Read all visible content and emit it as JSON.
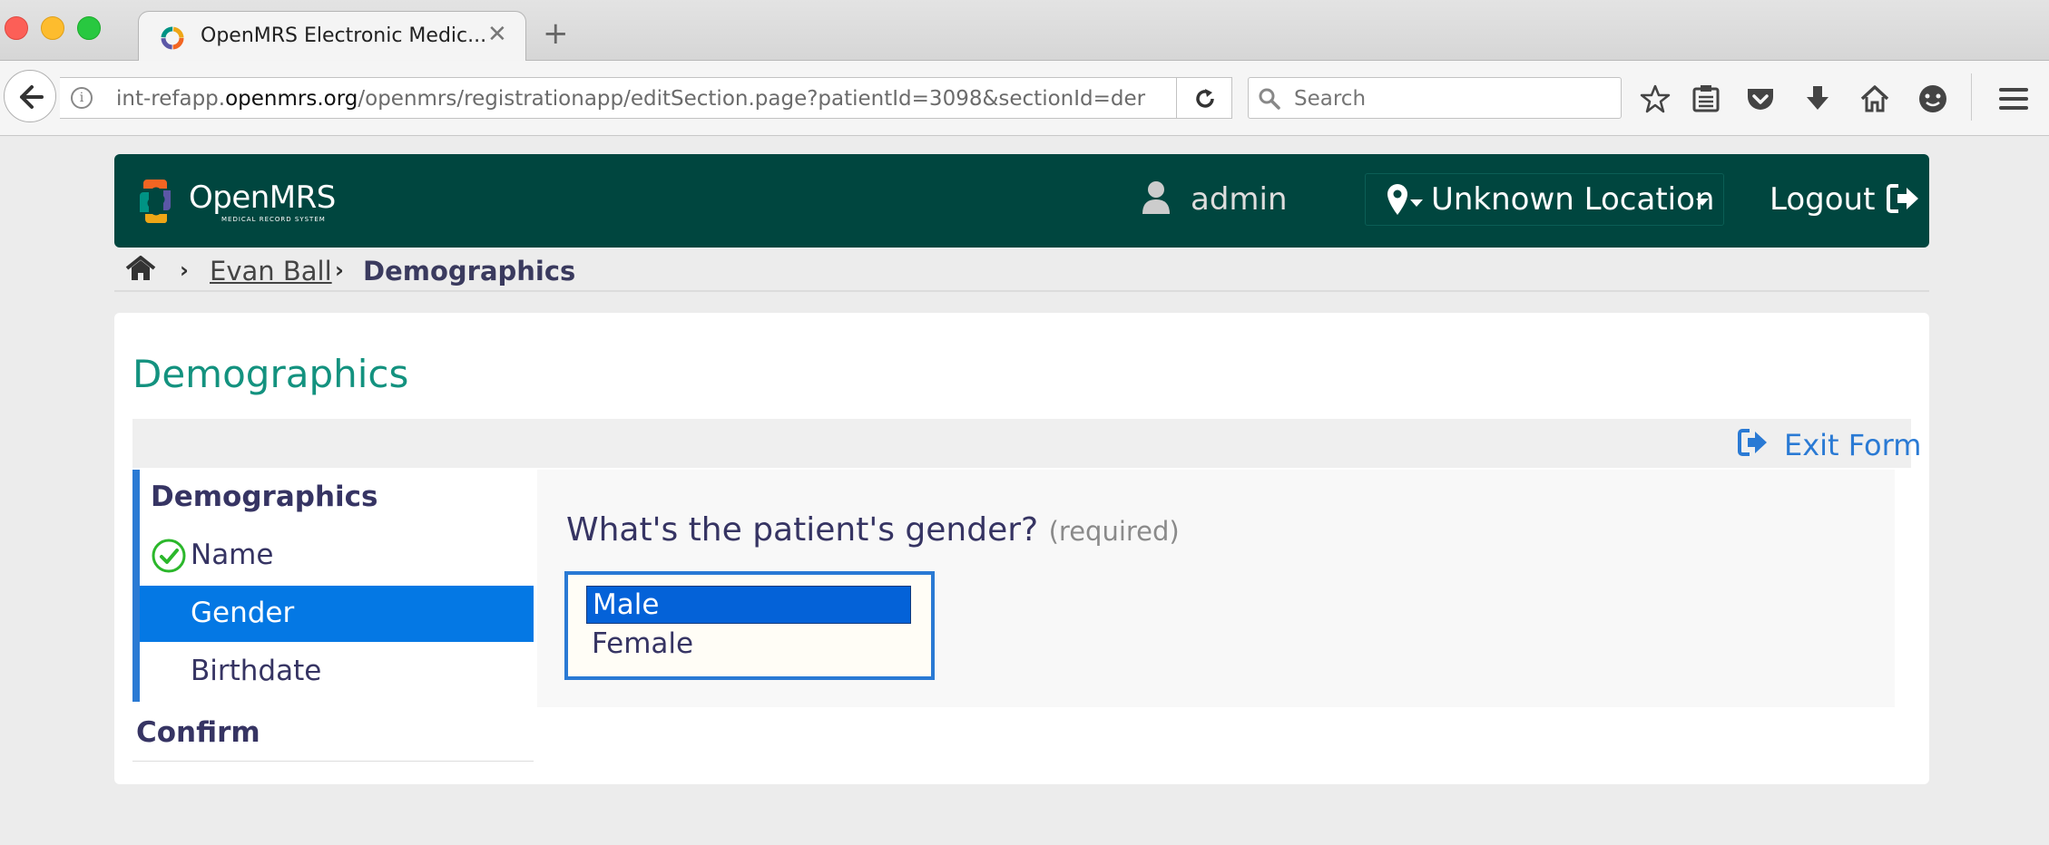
{
  "browser": {
    "tab_title": "OpenMRS Electronic Medic...",
    "url_prefix": "int-refapp.",
    "url_domain": "openmrs.org",
    "url_path": "/openmrs/registrationapp/editSection.page?patientId=3098&sectionId=der",
    "search_placeholder": "Search"
  },
  "header": {
    "logo_text": "OpenMRS",
    "logo_sub": "MEDICAL RECORD SYSTEM",
    "user": "admin",
    "location": "Unknown Location",
    "logout": "Logout",
    "brand_color": "#00463f"
  },
  "breadcrumb": {
    "patient": "Evan Ball",
    "current": "Demographics"
  },
  "main": {
    "title": "Demographics",
    "exit_form": "Exit Form",
    "section_title": "Demographics",
    "fields": [
      {
        "label": "Name",
        "status": "complete"
      },
      {
        "label": "Gender",
        "status": "active"
      },
      {
        "label": "Birthdate",
        "status": "pending"
      }
    ],
    "confirm": "Confirm",
    "question": "What's the patient's gender?",
    "required": "(required)",
    "options": [
      {
        "label": "Male",
        "selected": true
      },
      {
        "label": "Female",
        "selected": false
      }
    ]
  }
}
